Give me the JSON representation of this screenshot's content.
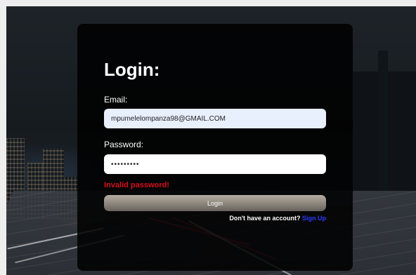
{
  "login": {
    "title": "Login:",
    "email_label": "Email:",
    "email_value": "mpumelelompanza98@GMAIL.COM",
    "password_label": "Password:",
    "password_value": "•••••••••",
    "error_message": "Invalid password!",
    "login_button": "Login",
    "signup_prompt": "Don't have an account?",
    "signup_link": "Sign Up"
  },
  "colors": {
    "card_background": "#000000",
    "error": "#d8101a",
    "link": "#2a3cff",
    "email_field_background": "#e8effd"
  }
}
